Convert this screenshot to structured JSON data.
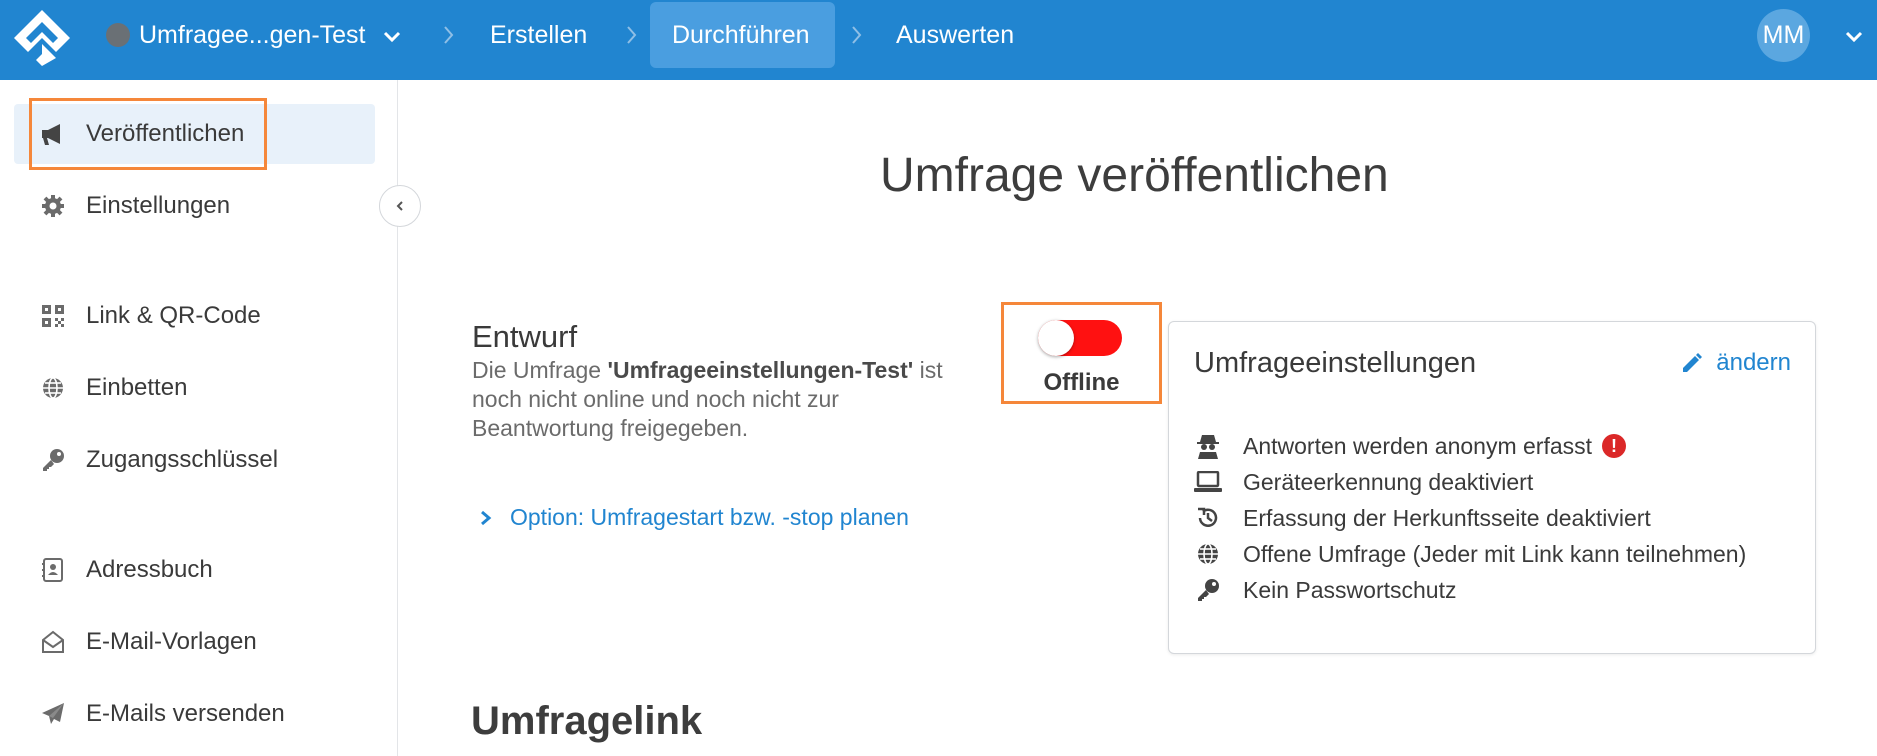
{
  "topbar": {
    "survey_name": "Umfragee...gen-Test",
    "steps": [
      "Erstellen",
      "Durchführen",
      "Auswerten"
    ],
    "active_step": "Durchführen",
    "avatar_initials": "MM",
    "color": "#2185d0"
  },
  "sidebar": {
    "items": [
      {
        "label": "Veröffentlichen",
        "icon": "megaphone-icon",
        "active": true
      },
      {
        "label": "Einstellungen",
        "icon": "gear-icon"
      },
      {
        "label": "Link & QR-Code",
        "icon": "qr-code-icon"
      },
      {
        "label": "Einbetten",
        "icon": "globe-icon"
      },
      {
        "label": "Zugangsschlüssel",
        "icon": "key-icon"
      },
      {
        "label": "Adressbuch",
        "icon": "address-book-icon"
      },
      {
        "label": "E-Mail-Vorlagen",
        "icon": "envelope-open-icon"
      },
      {
        "label": "E-Mails versenden",
        "icon": "paper-plane-icon"
      }
    ]
  },
  "main": {
    "title": "Umfrage veröffentlichen",
    "status": {
      "title": "Entwurf",
      "desc_prefix": "Die Umfrage ",
      "survey_name": "'Umfrageeinstellungen-Test'",
      "desc_suffix": " ist noch nicht online und noch nicht zur Beantwortung freigegeben.",
      "toggle_label": "Offline",
      "toggle_on": false,
      "toggle_color": "#ff1111"
    },
    "schedule_link": "Option: Umfragestart bzw. -stop planen",
    "settings_card": {
      "title": "Umfrageeinstellungen",
      "edit_label": "ändern",
      "rows": [
        {
          "icon": "spy-icon",
          "text": "Antworten werden anonym erfasst",
          "warning": true
        },
        {
          "icon": "laptop-icon",
          "text": "Geräteerkennung deaktiviert"
        },
        {
          "icon": "history-icon",
          "text": "Erfassung der Herkunftsseite deaktiviert"
        },
        {
          "icon": "globe-icon",
          "text": "Offene Umfrage (Jeder mit Link kann teilnehmen)"
        },
        {
          "icon": "key-icon",
          "text": "Kein Passwortschutz"
        }
      ]
    },
    "link_section_title": "Umfragelink"
  }
}
